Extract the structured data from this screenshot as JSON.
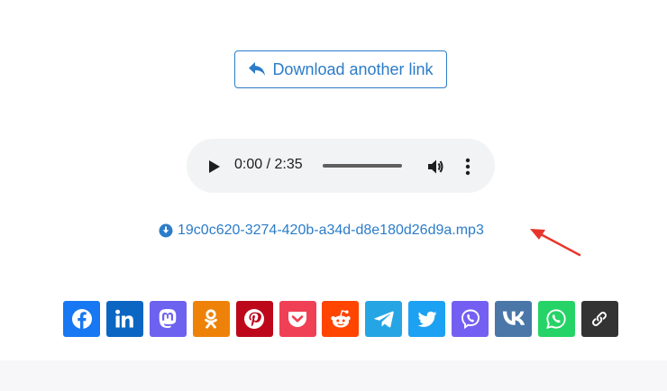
{
  "download_another": {
    "label": "Download another link",
    "icon": "reply-arrow-icon"
  },
  "audio_player": {
    "time": "0:00 / 2:35"
  },
  "file": {
    "name": "19c0c620-3274-420b-a34d-d8e180d26d9a.mp3",
    "icon": "circle-download-icon"
  },
  "annotation": {
    "color": "#e8352b"
  },
  "share_buttons": [
    {
      "network": "facebook",
      "color": "#1877f2"
    },
    {
      "network": "linkedin",
      "color": "#0a66c2"
    },
    {
      "network": "mastodon",
      "color": "#6d61f0"
    },
    {
      "network": "odnoklassniki",
      "color": "#ee8208"
    },
    {
      "network": "pinterest",
      "color": "#bd081c"
    },
    {
      "network": "pocket",
      "color": "#ef4056"
    },
    {
      "network": "reddit",
      "color": "#ff4500"
    },
    {
      "network": "telegram",
      "color": "#26a5e4"
    },
    {
      "network": "twitter",
      "color": "#1da1f2"
    },
    {
      "network": "viber",
      "color": "#7360f2"
    },
    {
      "network": "vk",
      "color": "#4a76a8"
    },
    {
      "network": "whatsapp",
      "color": "#25d366"
    },
    {
      "network": "copy-link",
      "color": "#333333"
    }
  ]
}
